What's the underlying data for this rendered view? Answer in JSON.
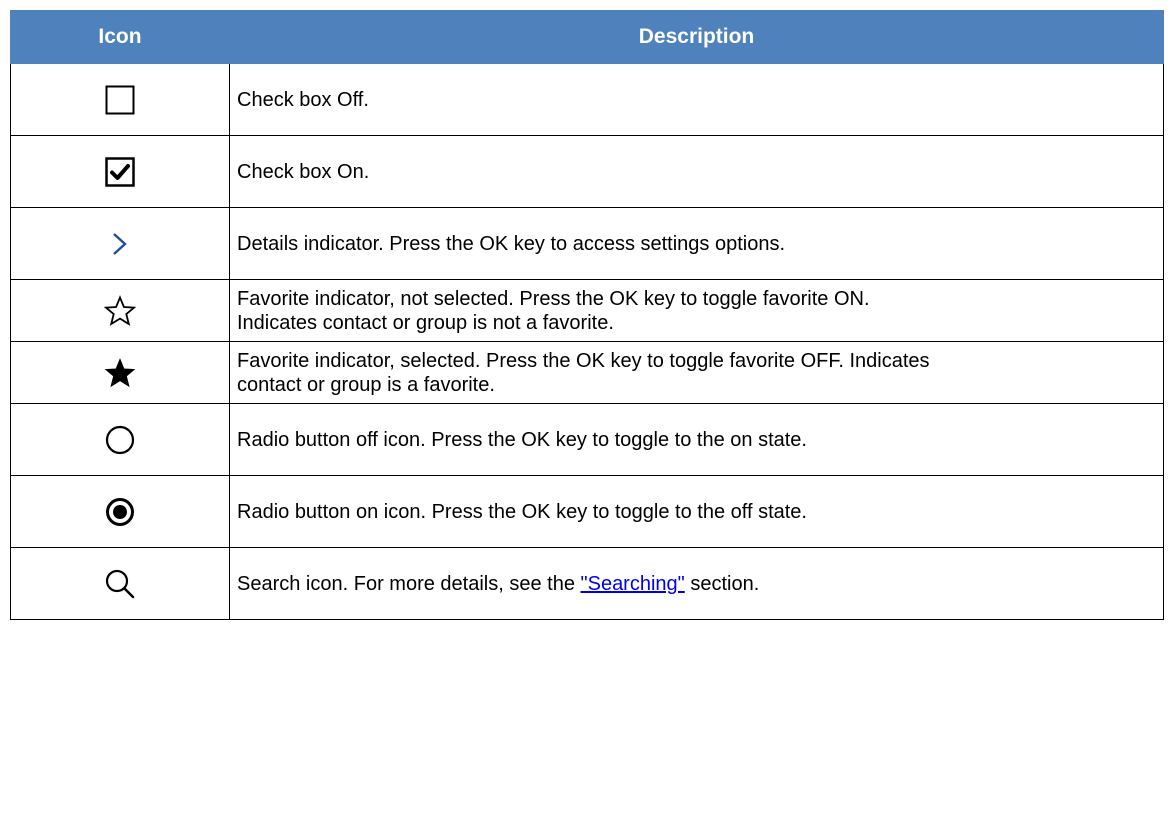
{
  "table": {
    "headers": {
      "icon": "Icon",
      "description": "Description"
    },
    "rows": [
      {
        "icon": "checkbox-off-icon",
        "description": [
          "Check box Off."
        ]
      },
      {
        "icon": "checkbox-on-icon",
        "description": [
          "Check box On."
        ]
      },
      {
        "icon": "chevron-right-icon",
        "description": [
          "Details indicator. Press the OK key to access settings options."
        ]
      },
      {
        "icon": "star-outline-icon",
        "description": [
          "Favorite indicator, not selected. Press the OK key to toggle favorite ON.",
          "Indicates contact or group is not a favorite."
        ]
      },
      {
        "icon": "star-filled-icon",
        "description": [
          "Favorite indicator, selected. Press the OK key to toggle favorite OFF. Indicates",
          "contact or group is a favorite."
        ]
      },
      {
        "icon": "radio-off-icon",
        "description": [
          "Radio button off icon. Press the OK key to toggle to the on state."
        ]
      },
      {
        "icon": "radio-on-icon",
        "description": [
          "Radio button on icon. Press the OK key to toggle to the off state."
        ]
      },
      {
        "icon": "search-icon",
        "description_parts": {
          "before": "Search icon. For more details, see the ",
          "link": "\"Searching\"",
          "after": " section."
        }
      }
    ]
  },
  "colors": {
    "header_bg": "#4f81bd",
    "header_text": "#ffffff",
    "chevron": "#1f4e9c",
    "link": "#0000ee"
  }
}
